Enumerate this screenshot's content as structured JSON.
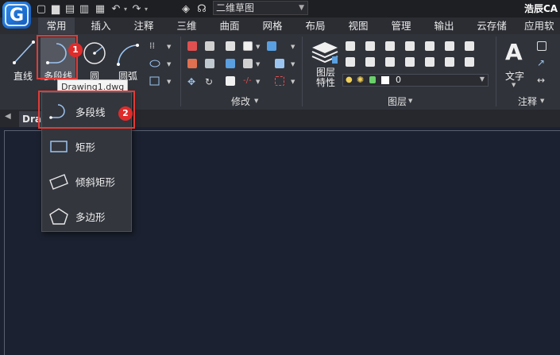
{
  "app": {
    "logo_letter": "G",
    "title": "浩辰CA",
    "workspace": "二维草图"
  },
  "menu_tabs": [
    {
      "label": "常用",
      "active": true
    },
    {
      "label": "插入"
    },
    {
      "label": "注释"
    },
    {
      "label": "三维"
    },
    {
      "label": "曲面"
    },
    {
      "label": "网格"
    },
    {
      "label": "布局"
    },
    {
      "label": "视图"
    },
    {
      "label": "管理"
    },
    {
      "label": "输出"
    },
    {
      "label": "云存储"
    },
    {
      "label": "应用软"
    }
  ],
  "draw_panel": {
    "line_label": "直线",
    "polyline_label": "多段线",
    "circle_label": "圆",
    "arc_label": "圆弧"
  },
  "modify_panel": {
    "label": "修改"
  },
  "layers_panel": {
    "label": "图层",
    "properties_label": "图层\n特性",
    "current_layer": "0"
  },
  "annotation_panel": {
    "label": "注释",
    "text_label": "文字"
  },
  "tooltip": "Drawing1.dwg",
  "document_tab": "Drav",
  "badges": [
    "1",
    "2"
  ],
  "polyline_dropdown": [
    {
      "label": "多段线",
      "icon": "polyline-icon"
    },
    {
      "label": "矩形",
      "icon": "rectangle-icon"
    },
    {
      "label": "倾斜矩形",
      "icon": "tilted-rectangle-icon"
    },
    {
      "label": "多边形",
      "icon": "polygon-icon"
    }
  ],
  "colors": {
    "highlight": "#e23a36",
    "canvas": "#1b2130",
    "ribbon": "#30333a"
  }
}
